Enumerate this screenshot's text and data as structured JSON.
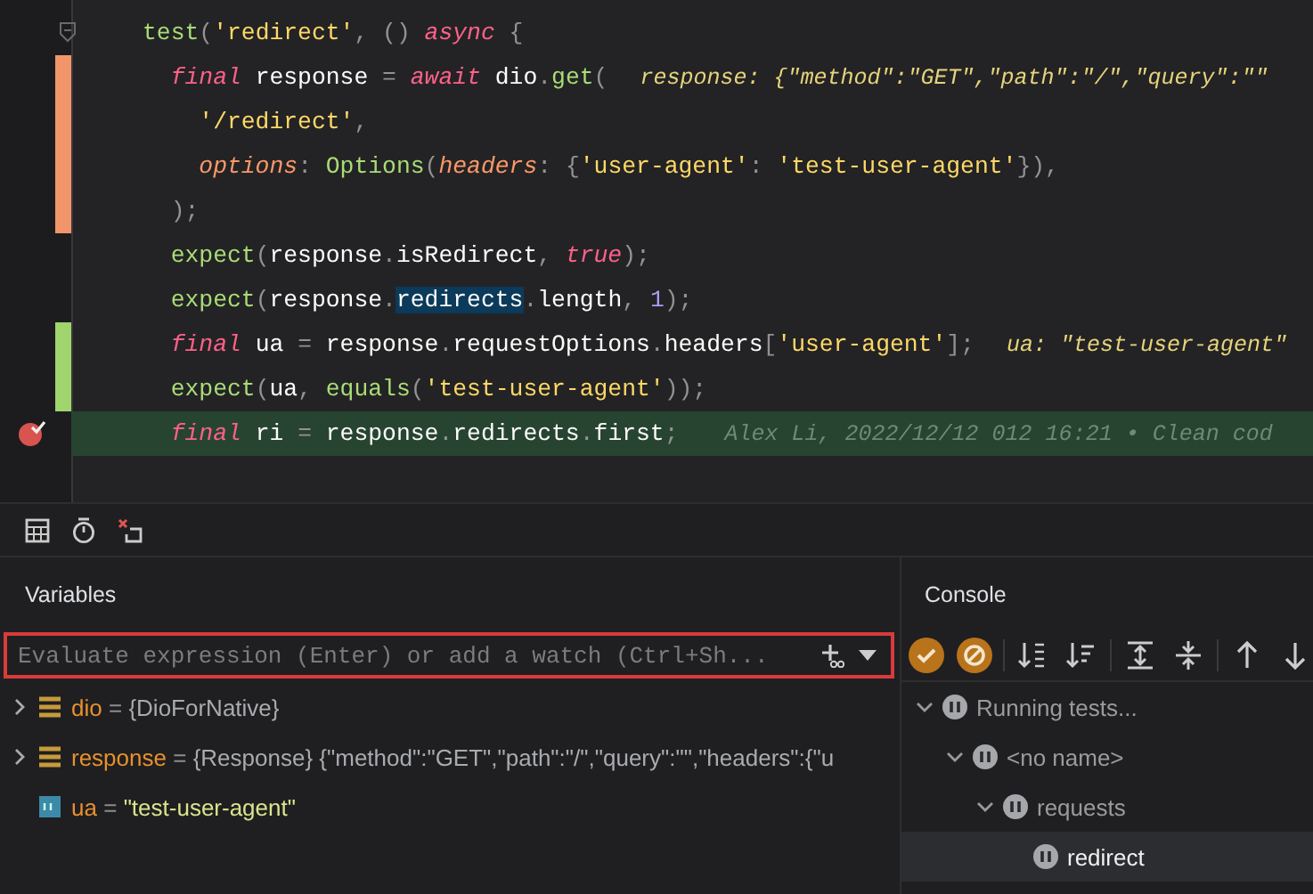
{
  "editor": {
    "lines": [
      {
        "modified": false,
        "added": false,
        "current": false,
        "fold": true,
        "breakpoint": false,
        "tokens": [
          {
            "kind": "fn",
            "text": "test"
          },
          {
            "kind": "punct",
            "text": "("
          },
          {
            "kind": "str",
            "text": "'redirect'"
          },
          {
            "kind": "punct",
            "text": ", () "
          },
          {
            "kind": "kw",
            "text": "async"
          },
          {
            "kind": "punct",
            "text": " {"
          }
        ]
      },
      {
        "modified": true,
        "added": false,
        "current": false,
        "fold": false,
        "breakpoint": false,
        "tokens": [
          {
            "kind": "kw",
            "text": "  final"
          },
          {
            "kind": "txt",
            "text": " response "
          },
          {
            "kind": "punct",
            "text": "= "
          },
          {
            "kind": "kw",
            "text": "await"
          },
          {
            "kind": "txt",
            "text": " dio"
          },
          {
            "kind": "punct",
            "text": "."
          },
          {
            "kind": "fn",
            "text": "get"
          },
          {
            "kind": "punct",
            "text": "("
          }
        ],
        "hint": "response: {\"method\":\"GET\",\"path\":\"/\",\"query\":\"\""
      },
      {
        "modified": true,
        "added": false,
        "current": false,
        "fold": false,
        "breakpoint": false,
        "tokens": [
          {
            "kind": "str",
            "text": "    '/redirect'"
          },
          {
            "kind": "punct",
            "text": ","
          }
        ]
      },
      {
        "modified": true,
        "added": false,
        "current": false,
        "fold": false,
        "breakpoint": false,
        "tokens": [
          {
            "kind": "param",
            "text": "    options"
          },
          {
            "kind": "punct",
            "text": ": "
          },
          {
            "kind": "fn",
            "text": "Options"
          },
          {
            "kind": "punct",
            "text": "("
          },
          {
            "kind": "param",
            "text": "headers"
          },
          {
            "kind": "punct",
            "text": ": {"
          },
          {
            "kind": "str",
            "text": "'user-agent'"
          },
          {
            "kind": "punct",
            "text": ": "
          },
          {
            "kind": "str",
            "text": "'test-user-agent'"
          },
          {
            "kind": "punct",
            "text": "}),"
          }
        ]
      },
      {
        "modified": true,
        "added": false,
        "current": false,
        "fold": false,
        "breakpoint": false,
        "tokens": [
          {
            "kind": "punct",
            "text": "  );"
          }
        ]
      },
      {
        "modified": false,
        "added": false,
        "current": false,
        "fold": false,
        "breakpoint": false,
        "tokens": [
          {
            "kind": "fn",
            "text": "  expect"
          },
          {
            "kind": "punct",
            "text": "("
          },
          {
            "kind": "txt",
            "text": "response"
          },
          {
            "kind": "punct",
            "text": "."
          },
          {
            "kind": "txt",
            "text": "isRedirect"
          },
          {
            "kind": "punct",
            "text": ", "
          },
          {
            "kind": "kw",
            "text": "true"
          },
          {
            "kind": "punct",
            "text": ");"
          }
        ]
      },
      {
        "modified": false,
        "added": false,
        "current": false,
        "fold": false,
        "breakpoint": false,
        "tokens": [
          {
            "kind": "fn",
            "text": "  expect"
          },
          {
            "kind": "punct",
            "text": "("
          },
          {
            "kind": "txt",
            "text": "response"
          },
          {
            "kind": "punct",
            "text": "."
          },
          {
            "kind": "match",
            "text": "redirects"
          },
          {
            "kind": "punct",
            "text": "."
          },
          {
            "kind": "txt",
            "text": "length"
          },
          {
            "kind": "punct",
            "text": ", "
          },
          {
            "kind": "num",
            "text": "1"
          },
          {
            "kind": "punct",
            "text": ");"
          }
        ]
      },
      {
        "modified": false,
        "added": true,
        "current": false,
        "fold": false,
        "breakpoint": false,
        "tokens": [
          {
            "kind": "kw",
            "text": "  final"
          },
          {
            "kind": "txt",
            "text": " ua "
          },
          {
            "kind": "punct",
            "text": "= "
          },
          {
            "kind": "txt",
            "text": "response"
          },
          {
            "kind": "punct",
            "text": "."
          },
          {
            "kind": "txt",
            "text": "requestOptions"
          },
          {
            "kind": "punct",
            "text": "."
          },
          {
            "kind": "txt",
            "text": "headers"
          },
          {
            "kind": "punct",
            "text": "["
          },
          {
            "kind": "str",
            "text": "'user-agent'"
          },
          {
            "kind": "punct",
            "text": "];"
          }
        ],
        "hint": "ua: \"test-user-agent\""
      },
      {
        "modified": false,
        "added": true,
        "current": false,
        "fold": false,
        "breakpoint": false,
        "tokens": [
          {
            "kind": "fn",
            "text": "  expect"
          },
          {
            "kind": "punct",
            "text": "("
          },
          {
            "kind": "txt",
            "text": "ua"
          },
          {
            "kind": "punct",
            "text": ", "
          },
          {
            "kind": "fn",
            "text": "equals"
          },
          {
            "kind": "punct",
            "text": "("
          },
          {
            "kind": "str",
            "text": "'test-user-agent'"
          },
          {
            "kind": "punct",
            "text": "));"
          }
        ]
      },
      {
        "modified": false,
        "added": false,
        "current": true,
        "fold": false,
        "breakpoint": true,
        "tokens": [
          {
            "kind": "kw",
            "text": "  final"
          },
          {
            "kind": "txt",
            "text": " ri "
          },
          {
            "kind": "punct",
            "text": "= "
          },
          {
            "kind": "txt",
            "text": "response"
          },
          {
            "kind": "punct",
            "text": "."
          },
          {
            "kind": "txt",
            "text": "redirects"
          },
          {
            "kind": "punct",
            "text": "."
          },
          {
            "kind": "txt",
            "text": "first"
          },
          {
            "kind": "punct",
            "text": ";"
          }
        ],
        "blame": "Alex Li, 2022/12/12 012 16:21 • Clean cod"
      }
    ]
  },
  "variables": {
    "title": "Variables",
    "placeholder": "Evaluate expression (Enter) or add a watch (Ctrl+Sh...",
    "items": [
      {
        "kind": "object",
        "expandable": true,
        "name": "dio",
        "operator": "=",
        "value": "{DioForNative}"
      },
      {
        "kind": "object",
        "expandable": true,
        "name": "response",
        "operator": "=",
        "value": "{Response} {\"method\":\"GET\",\"path\":\"/\",\"query\":\"\",\"headers\":{\"u"
      },
      {
        "kind": "string",
        "expandable": false,
        "name": "ua",
        "operator": "=",
        "value": "\"test-user-agent\""
      }
    ]
  },
  "console": {
    "title": "Console",
    "toolbar": [
      {
        "kind": "check",
        "on": true
      },
      {
        "kind": "cancel",
        "on": true
      },
      {
        "kind": "sort-alpha",
        "on": false
      },
      {
        "kind": "sort-duration",
        "on": false
      },
      {
        "kind": "expand",
        "on": false
      },
      {
        "kind": "collapse",
        "on": false
      },
      {
        "kind": "up",
        "on": false
      },
      {
        "kind": "down",
        "on": false
      }
    ],
    "tree": [
      {
        "label": "Running tests...",
        "expanded": true,
        "selected": false,
        "children": [
          {
            "label": "<no name>",
            "expanded": true,
            "selected": false,
            "children": [
              {
                "label": "requests",
                "expanded": true,
                "selected": false,
                "children": [
                  {
                    "label": "redirect",
                    "selected": true
                  }
                ]
              }
            ]
          }
        ]
      }
    ]
  }
}
